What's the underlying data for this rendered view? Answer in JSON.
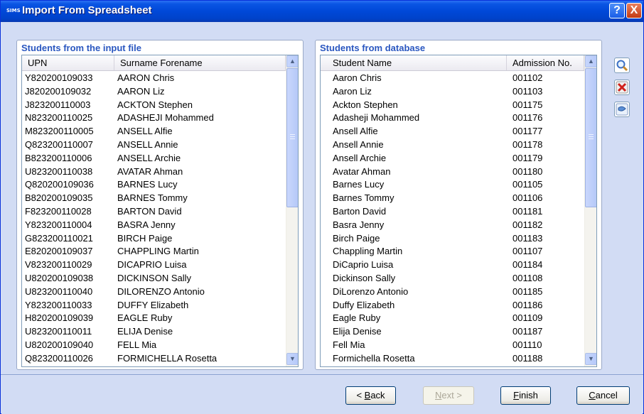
{
  "window": {
    "title": "Import From Spreadsheet",
    "logo_text": "SIMS",
    "help_glyph": "?",
    "close_glyph": "X"
  },
  "left": {
    "title": "Students from the input file",
    "columns": [
      "UPN",
      "Surname Forename"
    ],
    "rows": [
      [
        "Y820200109033",
        "AARON Chris"
      ],
      [
        "J820200109032",
        "AARON Liz"
      ],
      [
        "J823200110003",
        "ACKTON Stephen"
      ],
      [
        "N823200110025",
        "ADASHEJI Mohammed"
      ],
      [
        "M823200110005",
        "ANSELL Alfie"
      ],
      [
        "Q823200110007",
        "ANSELL Annie"
      ],
      [
        "B823200110006",
        "ANSELL Archie"
      ],
      [
        "U823200110038",
        "AVATAR Ahman"
      ],
      [
        "Q820200109036",
        "BARNES Lucy"
      ],
      [
        "B820200109035",
        "BARNES Tommy"
      ],
      [
        "F823200110028",
        "BARTON David"
      ],
      [
        "Y823200110004",
        "BASRA Jenny"
      ],
      [
        "G823200110021",
        "BIRCH Paige"
      ],
      [
        "E820200109037",
        "CHAPPLING Martin"
      ],
      [
        "V823200110029",
        "DICAPRIO Luisa"
      ],
      [
        "U820200109038",
        "DICKINSON Sally"
      ],
      [
        "U823200110040",
        "DILORENZO Antonio"
      ],
      [
        "Y823200110033",
        "DUFFY Elizabeth"
      ],
      [
        "H820200109039",
        "EAGLE Ruby"
      ],
      [
        "U823200110011",
        "ELIJA Denise"
      ],
      [
        "U820200109040",
        "FELL Mia"
      ],
      [
        "Q823200110026",
        "FORMICHELLA Rosetta"
      ]
    ]
  },
  "right": {
    "title": "Students from database",
    "columns": [
      "Student Name",
      "Admission No."
    ],
    "rows": [
      [
        "Aaron Chris",
        "001102"
      ],
      [
        "Aaron Liz",
        "001103"
      ],
      [
        "Ackton Stephen",
        "001175"
      ],
      [
        "Adasheji Mohammed",
        "001176"
      ],
      [
        "Ansell Alfie",
        "001177"
      ],
      [
        "Ansell Annie",
        "001178"
      ],
      [
        "Ansell Archie",
        "001179"
      ],
      [
        "Avatar Ahman",
        "001180"
      ],
      [
        "Barnes Lucy",
        "001105"
      ],
      [
        "Barnes Tommy",
        "001106"
      ],
      [
        "Barton David",
        "001181"
      ],
      [
        "Basra Jenny",
        "001182"
      ],
      [
        "Birch Paige",
        "001183"
      ],
      [
        "Chappling Martin",
        "001107"
      ],
      [
        "DiCaprio Luisa",
        "001184"
      ],
      [
        "Dickinson Sally",
        "001108"
      ],
      [
        "DiLorenzo Antonio",
        "001185"
      ],
      [
        "Duffy Elizabeth",
        "001186"
      ],
      [
        "Eagle Ruby",
        "001109"
      ],
      [
        "Elija Denise",
        "001187"
      ],
      [
        "Fell Mia",
        "001110"
      ],
      [
        "Formichella Rosetta",
        "001188"
      ]
    ]
  },
  "side_icons": [
    "search-icon",
    "delete-icon",
    "link-icon"
  ],
  "buttons": {
    "back": {
      "key": "B",
      "rest": "ack",
      "prefix": "< "
    },
    "next": {
      "key": "N",
      "rest": "ext",
      "suffix": " >"
    },
    "finish": {
      "key": "F",
      "rest": "inish"
    },
    "cancel": {
      "key": "C",
      "rest": "ancel"
    }
  },
  "colors": {
    "title_bar": "#0048d8",
    "group_title": "#2a57c0",
    "dialog_bg": "#d2dcf4"
  }
}
